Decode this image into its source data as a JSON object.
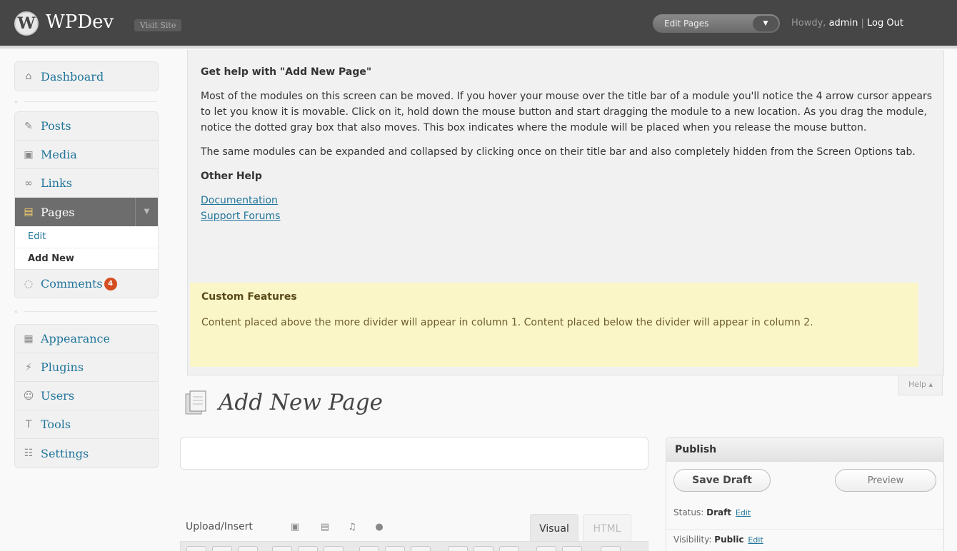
{
  "header": {
    "site_title": "WPDev",
    "visit_site": "Visit Site",
    "favorite_actions_label": "Edit Pages",
    "howdy_prefix": "Howdy,",
    "username": "admin",
    "separator": "|",
    "logout_label": "Log Out"
  },
  "sidebar": {
    "dashboard": "Dashboard",
    "posts": "Posts",
    "media": "Media",
    "links": "Links",
    "pages": "Pages",
    "pages_sub_edit": "Edit",
    "pages_sub_add_new": "Add New",
    "comments": "Comments",
    "comments_badge": "4",
    "appearance": "Appearance",
    "plugins": "Plugins",
    "users": "Users",
    "tools": "Tools",
    "settings": "Settings"
  },
  "help": {
    "heading": "Get help with \"Add New Page\"",
    "para1": "Most of the modules on this screen can be moved. If you hover your mouse over the title bar of a module you'll notice the 4 arrow cursor appears to let you know it is movable. Click on it, hold down the mouse button and start dragging the module to a new location. As you drag the module, notice the dotted gray box that also moves. This box indicates where the module will be placed when you release the mouse button.",
    "para2": "The same modules can be expanded and collapsed by clicking once on their title bar and also completely hidden from the Screen Options tab.",
    "other_help_heading": "Other Help",
    "link_documentation": "Documentation",
    "link_support_forums": "Support Forums",
    "custom_heading": "Custom Features",
    "custom_text": "Content placed above the more divider will appear in column 1. Content placed below the divider will appear in column 2.",
    "help_tab_label": "Help ▴"
  },
  "main": {
    "page_title": "Add New Page",
    "title_input_value": "",
    "upload_insert_label": "Upload/Insert",
    "tab_visual": "Visual",
    "tab_html": "HTML"
  },
  "publish": {
    "heading": "Publish",
    "save_draft": "Save Draft",
    "preview": "Preview",
    "status_label": "Status:",
    "status_value": "Draft",
    "visibility_label": "Visibility:",
    "visibility_value": "Public",
    "edit_link": "Edit"
  },
  "colors": {
    "header_bg": "#464646",
    "link": "#21759b",
    "badge": "#d54e21",
    "custom_box_bg": "#fbf6c8"
  }
}
